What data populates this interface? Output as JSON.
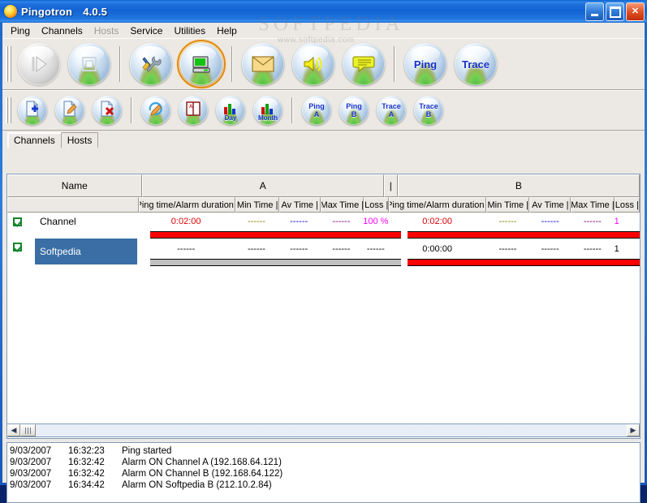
{
  "window": {
    "app_name": "Pingotron",
    "version": "4.0.5",
    "icon": "app-orb-icon",
    "minimize_label": "Minimize",
    "maximize_label": "Maximize",
    "close_label": "Close"
  },
  "watermark": {
    "line1": "SOFTPEDIA",
    "line2": "www.softpedia.com"
  },
  "menu": [
    {
      "label": "Ping",
      "disabled": false
    },
    {
      "label": "Channels",
      "disabled": false
    },
    {
      "label": "Hosts",
      "disabled": true
    },
    {
      "label": "Service",
      "disabled": false
    },
    {
      "label": "Utilities",
      "disabled": false
    },
    {
      "label": "Help",
      "disabled": false
    }
  ],
  "toolbar_main": [
    {
      "name": "start-button",
      "icon": "play-icon",
      "label": "",
      "state": "disabled"
    },
    {
      "name": "stop-button",
      "icon": "stop-icon",
      "label": "",
      "state": "normal"
    },
    {
      "name": "settings-button",
      "icon": "tools-icon",
      "label": "",
      "state": "normal"
    },
    {
      "name": "monitor-button",
      "icon": "computer-icon",
      "label": "",
      "state": "selected"
    },
    {
      "name": "mail-button",
      "icon": "envelope-icon",
      "label": "",
      "state": "normal"
    },
    {
      "name": "sound-button",
      "icon": "speaker-icon",
      "label": "",
      "state": "normal"
    },
    {
      "name": "message-button",
      "icon": "speech-bubble-icon",
      "label": "",
      "state": "normal"
    },
    {
      "name": "ping-button",
      "icon": "text-icon",
      "label": "Ping",
      "state": "normal"
    },
    {
      "name": "trace-button",
      "icon": "text-icon",
      "label": "Trace",
      "state": "normal"
    }
  ],
  "toolbar_secondary": [
    {
      "name": "add-channel-button",
      "icon": "document-add-icon",
      "label": "",
      "sublabel": ""
    },
    {
      "name": "edit-channel-button",
      "icon": "document-edit-icon",
      "label": "",
      "sublabel": ""
    },
    {
      "name": "delete-channel-button",
      "icon": "document-delete-icon",
      "label": "",
      "sublabel": ""
    },
    {
      "name": "edit-log-button",
      "icon": "pencil-circle-icon",
      "label": "",
      "sublabel": ""
    },
    {
      "name": "address-book-button",
      "icon": "address-book-icon",
      "label": "",
      "sublabel": ""
    },
    {
      "name": "day-graph-button",
      "icon": "bar-chart-icon",
      "label": "",
      "sublabel": "Day"
    },
    {
      "name": "month-graph-button",
      "icon": "bar-chart-icon",
      "label": "",
      "sublabel": "Month"
    },
    {
      "name": "ping-a-button",
      "icon": "text-icon",
      "label": "Ping\nA",
      "sublabel": ""
    },
    {
      "name": "ping-b-button",
      "icon": "text-icon",
      "label": "Ping\nB",
      "sublabel": ""
    },
    {
      "name": "trace-a-button",
      "icon": "text-icon",
      "label": "Trace\nA",
      "sublabel": ""
    },
    {
      "name": "trace-b-button",
      "icon": "text-icon",
      "label": "Trace\nB",
      "sublabel": ""
    }
  ],
  "tabs": [
    {
      "label": "Channels",
      "active": true
    },
    {
      "label": "Hosts",
      "active": false
    }
  ],
  "grid": {
    "name_header": "Name",
    "group_a": "A",
    "group_b": "B",
    "divider_header": "|",
    "sub_headers": [
      "Ping time/Alarm duration |",
      "Min Time |",
      "Av Time |",
      "Max Time |",
      "Loss |"
    ],
    "rows": [
      {
        "checked": true,
        "name": "Channel",
        "selected": false,
        "a": {
          "ping": "0:02:00",
          "ping_color": "#e00000",
          "min": "------",
          "min_color": "#808000",
          "av": "------",
          "av_color": "#0000d0",
          "max": "------",
          "max_color": "#800080",
          "loss": "100 %",
          "loss_color": "#ff00ff",
          "bar": "red"
        },
        "b": {
          "ping": "0:02:00",
          "ping_color": "#e00000",
          "min": "------",
          "min_color": "#808000",
          "av": "------",
          "av_color": "#0000d0",
          "max": "------",
          "max_color": "#800080",
          "loss": "1",
          "loss_color": "#ff00ff",
          "bar": "red"
        }
      },
      {
        "checked": true,
        "name": "Softpedia",
        "selected": true,
        "a": {
          "ping": "------",
          "ping_color": "#000000",
          "min": "------",
          "min_color": "#000000",
          "av": "------",
          "av_color": "#000000",
          "max": "------",
          "max_color": "#000000",
          "loss": "------",
          "loss_color": "#000000",
          "bar": "grey"
        },
        "b": {
          "ping": "0:00:00",
          "ping_color": "#000000",
          "min": "------",
          "min_color": "#000000",
          "av": "------",
          "av_color": "#000000",
          "max": "------",
          "max_color": "#000000",
          "loss": "1",
          "loss_color": "#000000",
          "bar": "red"
        }
      }
    ]
  },
  "scrollbar": {
    "left_arrow": "◀",
    "right_arrow": "▶"
  },
  "log": [
    {
      "date": "9/03/2007",
      "time": "16:32:23",
      "message": "Ping started"
    },
    {
      "date": "9/03/2007",
      "time": "16:32:42",
      "message": "Alarm ON Channel A (192.168.64.121)"
    },
    {
      "date": "9/03/2007",
      "time": "16:32:42",
      "message": "Alarm ON Channel B (192.168.64.122)"
    },
    {
      "date": "9/03/2007",
      "time": "16:34:42",
      "message": "Alarm ON Softpedia B (212.10.2.84)"
    }
  ]
}
